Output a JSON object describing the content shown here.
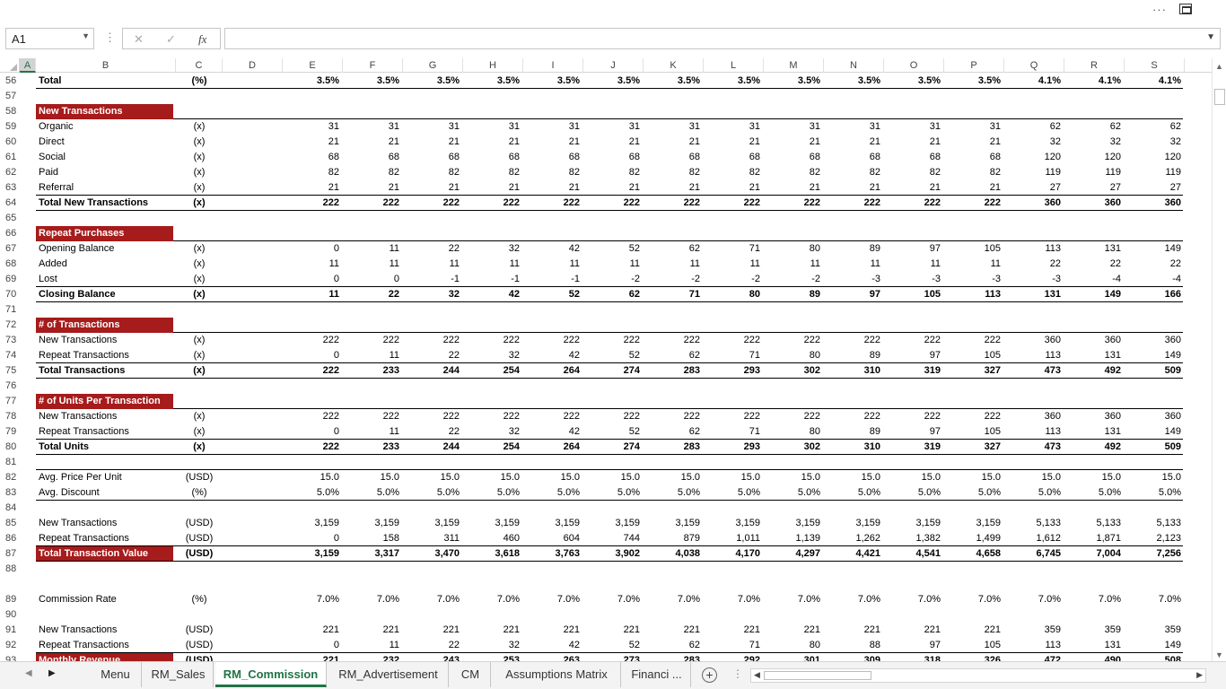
{
  "window": {
    "more_label": "···"
  },
  "formula_bar": {
    "name_box": "A1",
    "cancel_icon": "✕",
    "enter_icon": "✓",
    "fx_label": "fx",
    "content": ""
  },
  "columns": [
    "A",
    "B",
    "C",
    "D",
    "E",
    "F",
    "G",
    "H",
    "I",
    "J",
    "K",
    "L",
    "M",
    "N",
    "O",
    "P",
    "Q",
    "R",
    "S"
  ],
  "selected_column": "A",
  "rows": [
    {
      "n": "56",
      "label": "Total",
      "unit": "(%)",
      "vals": [
        "3.5%",
        "3.5%",
        "3.5%",
        "3.5%",
        "3.5%",
        "3.5%",
        "3.5%",
        "3.5%",
        "3.5%",
        "3.5%",
        "3.5%",
        "3.5%",
        "4.1%",
        "4.1%",
        "4.1%"
      ],
      "style": "bold",
      "line": "below"
    },
    {
      "n": "57",
      "label": "",
      "unit": "",
      "vals": []
    },
    {
      "n": "58",
      "label": "New Transactions",
      "unit": "",
      "vals": [],
      "style": "sect",
      "line": "below"
    },
    {
      "n": "59",
      "label": "Organic",
      "unit": "(x)",
      "vals": [
        "31",
        "31",
        "31",
        "31",
        "31",
        "31",
        "31",
        "31",
        "31",
        "31",
        "31",
        "31",
        "62",
        "62",
        "62"
      ]
    },
    {
      "n": "60",
      "label": "Direct",
      "unit": "(x)",
      "vals": [
        "21",
        "21",
        "21",
        "21",
        "21",
        "21",
        "21",
        "21",
        "21",
        "21",
        "21",
        "21",
        "32",
        "32",
        "32"
      ]
    },
    {
      "n": "61",
      "label": "Social",
      "unit": "(x)",
      "vals": [
        "68",
        "68",
        "68",
        "68",
        "68",
        "68",
        "68",
        "68",
        "68",
        "68",
        "68",
        "68",
        "120",
        "120",
        "120"
      ]
    },
    {
      "n": "62",
      "label": "Paid",
      "unit": "(x)",
      "vals": [
        "82",
        "82",
        "82",
        "82",
        "82",
        "82",
        "82",
        "82",
        "82",
        "82",
        "82",
        "82",
        "119",
        "119",
        "119"
      ]
    },
    {
      "n": "63",
      "label": "Referral",
      "unit": "(x)",
      "vals": [
        "21",
        "21",
        "21",
        "21",
        "21",
        "21",
        "21",
        "21",
        "21",
        "21",
        "21",
        "21",
        "27",
        "27",
        "27"
      ],
      "line": "below"
    },
    {
      "n": "64",
      "label": "Total New Transactions",
      "unit": "(x)",
      "vals": [
        "222",
        "222",
        "222",
        "222",
        "222",
        "222",
        "222",
        "222",
        "222",
        "222",
        "222",
        "222",
        "360",
        "360",
        "360"
      ],
      "style": "bold",
      "line": "below"
    },
    {
      "n": "65",
      "label": "",
      "unit": "",
      "vals": []
    },
    {
      "n": "66",
      "label": "Repeat Purchases",
      "unit": "",
      "vals": [],
      "style": "sect",
      "line": "below"
    },
    {
      "n": "67",
      "label": "Opening Balance",
      "unit": "(x)",
      "vals": [
        "0",
        "11",
        "22",
        "32",
        "42",
        "52",
        "62",
        "71",
        "80",
        "89",
        "97",
        "105",
        "113",
        "131",
        "149"
      ]
    },
    {
      "n": "68",
      "label": "Added",
      "unit": "(x)",
      "vals": [
        "11",
        "11",
        "11",
        "11",
        "11",
        "11",
        "11",
        "11",
        "11",
        "11",
        "11",
        "11",
        "22",
        "22",
        "22"
      ]
    },
    {
      "n": "69",
      "label": "Lost",
      "unit": "(x)",
      "vals": [
        "0",
        "0",
        "-1",
        "-1",
        "-1",
        "-2",
        "-2",
        "-2",
        "-2",
        "-3",
        "-3",
        "-3",
        "-3",
        "-4",
        "-4"
      ],
      "line": "below"
    },
    {
      "n": "70",
      "label": "Closing Balance",
      "unit": "(x)",
      "vals": [
        "11",
        "22",
        "32",
        "42",
        "52",
        "62",
        "71",
        "80",
        "89",
        "97",
        "105",
        "113",
        "131",
        "149",
        "166"
      ],
      "style": "bold",
      "line": "below"
    },
    {
      "n": "71",
      "label": "",
      "unit": "",
      "vals": []
    },
    {
      "n": "72",
      "label": "# of Transactions",
      "unit": "",
      "vals": [],
      "style": "sect",
      "line": "below"
    },
    {
      "n": "73",
      "label": "New Transactions",
      "unit": "(x)",
      "vals": [
        "222",
        "222",
        "222",
        "222",
        "222",
        "222",
        "222",
        "222",
        "222",
        "222",
        "222",
        "222",
        "360",
        "360",
        "360"
      ]
    },
    {
      "n": "74",
      "label": "Repeat Transactions",
      "unit": "(x)",
      "vals": [
        "0",
        "11",
        "22",
        "32",
        "42",
        "52",
        "62",
        "71",
        "80",
        "89",
        "97",
        "105",
        "113",
        "131",
        "149"
      ],
      "line": "below"
    },
    {
      "n": "75",
      "label": "Total Transactions",
      "unit": "(x)",
      "vals": [
        "222",
        "233",
        "244",
        "254",
        "264",
        "274",
        "283",
        "293",
        "302",
        "310",
        "319",
        "327",
        "473",
        "492",
        "509"
      ],
      "style": "bold",
      "line": "below"
    },
    {
      "n": "76",
      "label": "",
      "unit": "",
      "vals": []
    },
    {
      "n": "77",
      "label": "# of Units Per Transaction",
      "unit": "",
      "vals": [],
      "style": "sect",
      "line": "below"
    },
    {
      "n": "78",
      "label": "New Transactions",
      "unit": "(x)",
      "vals": [
        "222",
        "222",
        "222",
        "222",
        "222",
        "222",
        "222",
        "222",
        "222",
        "222",
        "222",
        "222",
        "360",
        "360",
        "360"
      ]
    },
    {
      "n": "79",
      "label": "Repeat Transactions",
      "unit": "(x)",
      "vals": [
        "0",
        "11",
        "22",
        "32",
        "42",
        "52",
        "62",
        "71",
        "80",
        "89",
        "97",
        "105",
        "113",
        "131",
        "149"
      ],
      "line": "below"
    },
    {
      "n": "80",
      "label": "Total Units",
      "unit": "(x)",
      "vals": [
        "222",
        "233",
        "244",
        "254",
        "264",
        "274",
        "283",
        "293",
        "302",
        "310",
        "319",
        "327",
        "473",
        "492",
        "509"
      ],
      "style": "bold",
      "line": "below"
    },
    {
      "n": "81",
      "label": "",
      "unit": "",
      "vals": [],
      "line": "below"
    },
    {
      "n": "82",
      "label": "Avg. Price Per Unit",
      "unit": "(USD)",
      "vals": [
        "15.0",
        "15.0",
        "15.0",
        "15.0",
        "15.0",
        "15.0",
        "15.0",
        "15.0",
        "15.0",
        "15.0",
        "15.0",
        "15.0",
        "15.0",
        "15.0",
        "15.0"
      ]
    },
    {
      "n": "83",
      "label": "Avg. Discount",
      "unit": "(%)",
      "vals": [
        "5.0%",
        "5.0%",
        "5.0%",
        "5.0%",
        "5.0%",
        "5.0%",
        "5.0%",
        "5.0%",
        "5.0%",
        "5.0%",
        "5.0%",
        "5.0%",
        "5.0%",
        "5.0%",
        "5.0%"
      ],
      "line": "below"
    },
    {
      "n": "84",
      "label": "",
      "unit": "",
      "vals": []
    },
    {
      "n": "85",
      "label": "New Transactions",
      "unit": "(USD)",
      "vals": [
        "3,159",
        "3,159",
        "3,159",
        "3,159",
        "3,159",
        "3,159",
        "3,159",
        "3,159",
        "3,159",
        "3,159",
        "3,159",
        "3,159",
        "5,133",
        "5,133",
        "5,133"
      ]
    },
    {
      "n": "86",
      "label": "Repeat Transactions",
      "unit": "(USD)",
      "vals": [
        "0",
        "158",
        "311",
        "460",
        "604",
        "744",
        "879",
        "1,011",
        "1,139",
        "1,262",
        "1,382",
        "1,499",
        "1,612",
        "1,871",
        "2,123"
      ],
      "line": "below"
    },
    {
      "n": "87",
      "label": "Total Transaction Value",
      "unit": "(USD)",
      "vals": [
        "3,159",
        "3,317",
        "3,470",
        "3,618",
        "3,763",
        "3,902",
        "4,038",
        "4,170",
        "4,297",
        "4,421",
        "4,541",
        "4,658",
        "6,745",
        "7,004",
        "7,256"
      ],
      "style": "sectbold",
      "line": "below"
    },
    {
      "n": "88",
      "label": "",
      "unit": "",
      "vals": []
    },
    {
      "n": "89",
      "label": "Commission Rate",
      "unit": "(%)",
      "vals": [
        "7.0%",
        "7.0%",
        "7.0%",
        "7.0%",
        "7.0%",
        "7.0%",
        "7.0%",
        "7.0%",
        "7.0%",
        "7.0%",
        "7.0%",
        "7.0%",
        "7.0%",
        "7.0%",
        "7.0%"
      ],
      "tall": true
    },
    {
      "n": "90",
      "label": "",
      "unit": "",
      "vals": []
    },
    {
      "n": "91",
      "label": "New Transactions",
      "unit": "(USD)",
      "vals": [
        "221",
        "221",
        "221",
        "221",
        "221",
        "221",
        "221",
        "221",
        "221",
        "221",
        "221",
        "221",
        "359",
        "359",
        "359"
      ]
    },
    {
      "n": "92",
      "label": "Repeat Transactions",
      "unit": "(USD)",
      "vals": [
        "0",
        "11",
        "22",
        "32",
        "42",
        "52",
        "62",
        "71",
        "80",
        "88",
        "97",
        "105",
        "113",
        "131",
        "149"
      ],
      "line": "below"
    },
    {
      "n": "93",
      "label": "Monthly Revenue",
      "unit": "(USD)",
      "vals": [
        "221",
        "232",
        "243",
        "253",
        "263",
        "273",
        "283",
        "292",
        "301",
        "309",
        "318",
        "326",
        "472",
        "490",
        "508"
      ],
      "style": "sectbold",
      "line": "below"
    },
    {
      "n": "94",
      "label": "",
      "unit": "",
      "vals": []
    }
  ],
  "sheet_tabs": [
    {
      "label": "Menu",
      "active": false
    },
    {
      "label": "RM_Sales",
      "active": false
    },
    {
      "label": "RM_Commission",
      "active": true
    },
    {
      "label": "RM_Advertisement",
      "active": false
    },
    {
      "label": "CM",
      "active": false
    },
    {
      "label": "Assumptions Matrix",
      "active": false
    },
    {
      "label": "Financi ...",
      "active": false
    }
  ],
  "colors": {
    "section_fill": "#a61b1b",
    "accent": "#217346"
  }
}
